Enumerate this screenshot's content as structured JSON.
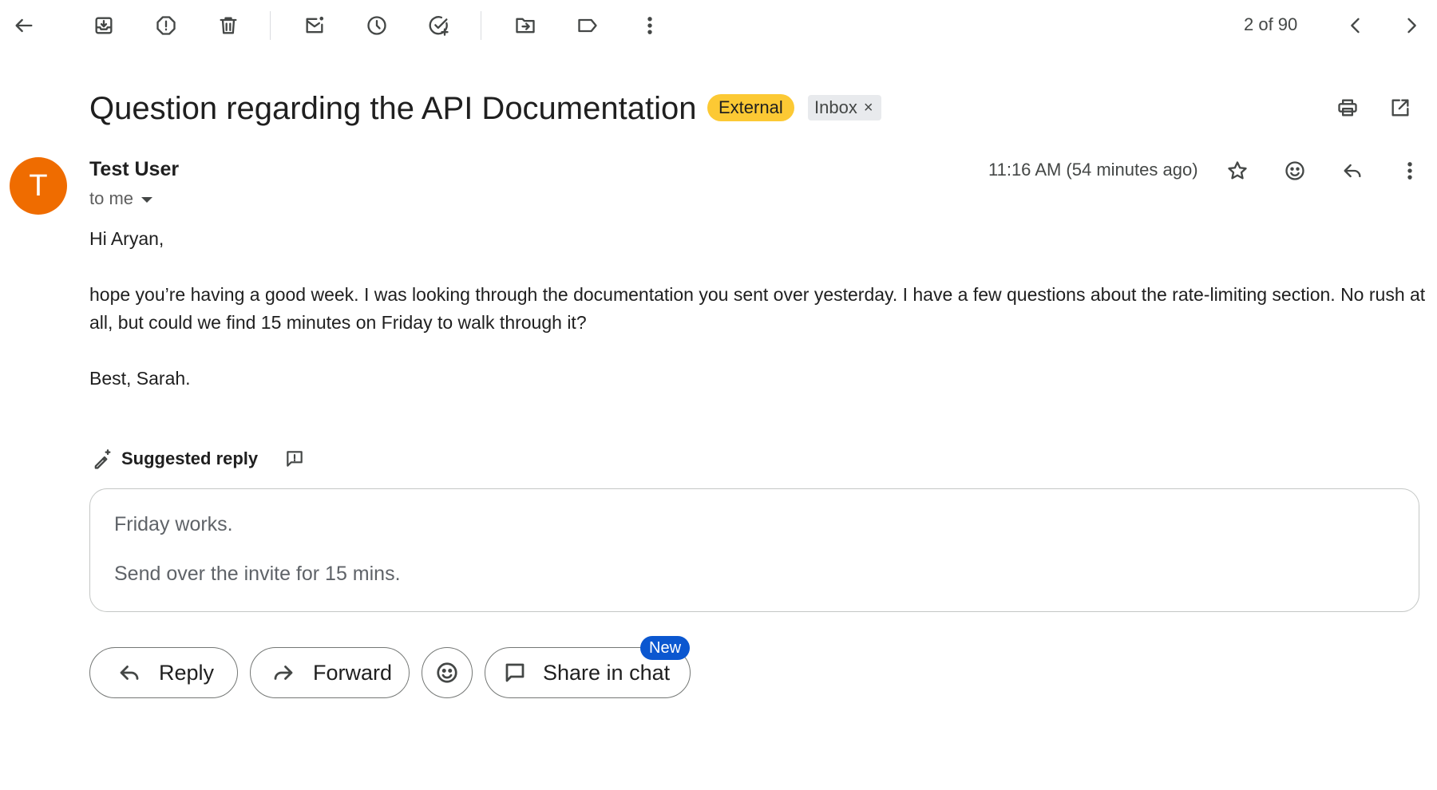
{
  "toolbar": {
    "icons": [
      "back-arrow-icon",
      "archive-icon",
      "report-spam-icon",
      "delete-icon",
      "mark-unread-icon",
      "snooze-icon",
      "add-task-icon",
      "move-to-icon",
      "label-icon",
      "more-vert-icon"
    ]
  },
  "pagination": {
    "counter": "2 of 90"
  },
  "email": {
    "subject": "Question regarding the API Documentation",
    "labels": {
      "external": "External",
      "inbox": "Inbox"
    },
    "sender": {
      "initial": "T",
      "name": "Test User",
      "avatar_color": "#ef6c00"
    },
    "recipient_label": "to me",
    "time": "11:16 AM (54 minutes ago)",
    "body": {
      "greeting": "Hi Aryan,",
      "paragraph": "hope you’re having a good week. I was looking through the documentation you sent over yesterday. I have a few questions about the rate-limiting section. No rush at all, but could we find 15 minutes on Friday to walk through it?",
      "signoff": "Best, Sarah."
    }
  },
  "suggested_reply": {
    "label": "Suggested reply",
    "lines": [
      "Friday works.",
      "Send over the invite for 15 mins."
    ]
  },
  "actions": {
    "reply": "Reply",
    "forward": "Forward",
    "share_in_chat": "Share in chat",
    "new_badge": "New"
  },
  "colors": {
    "external_badge": "#fcc934",
    "new_badge": "#0b57d0"
  }
}
